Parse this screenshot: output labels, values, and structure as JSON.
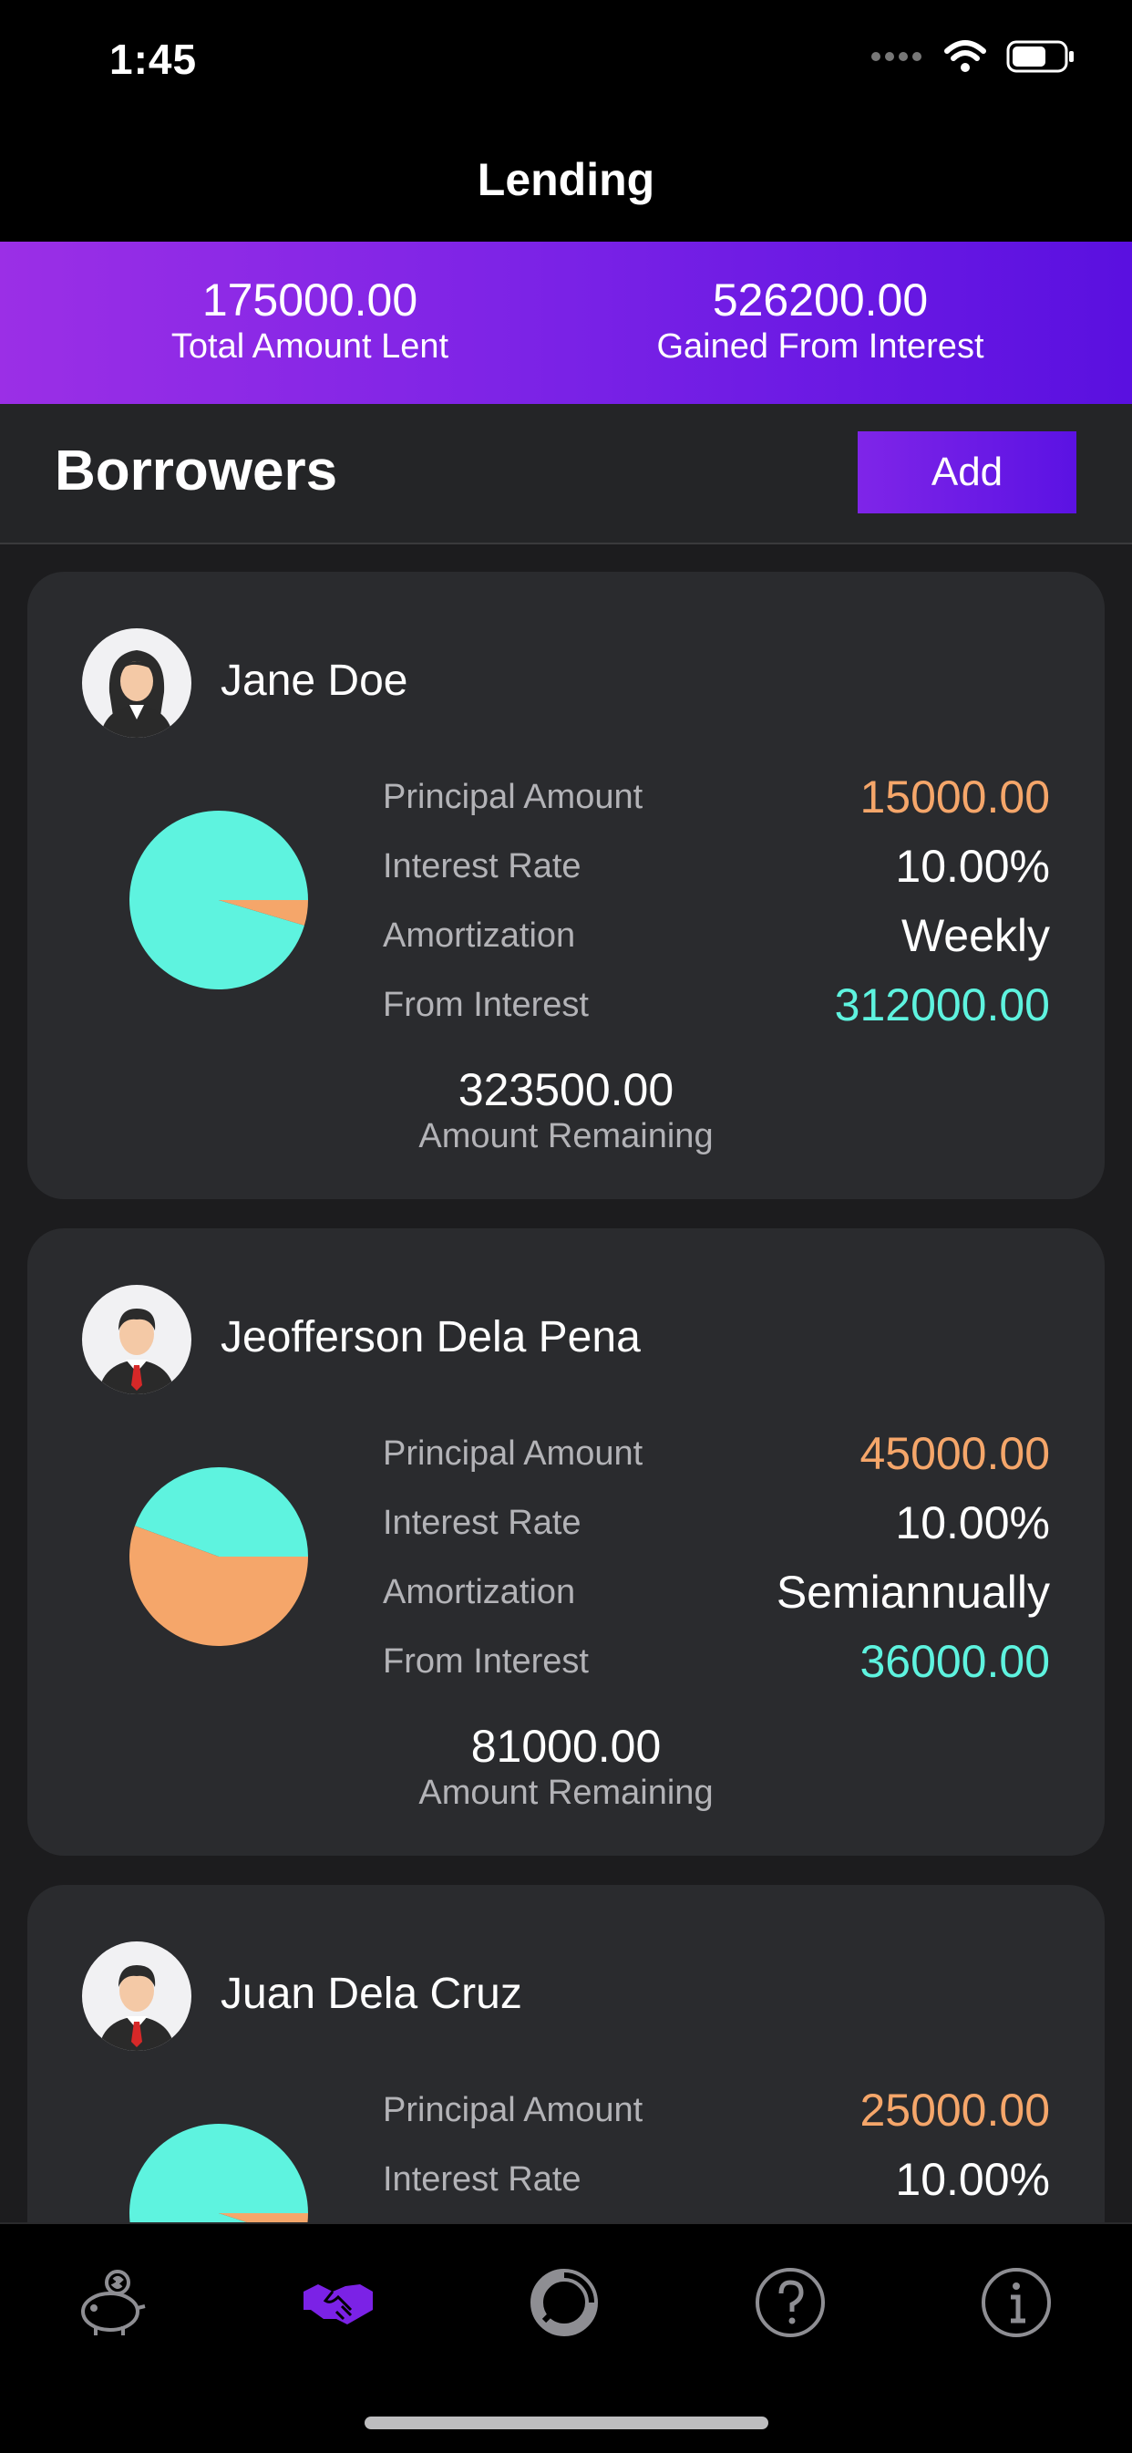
{
  "status_bar": {
    "time": "1:45",
    "icons": [
      "signal-icon",
      "wifi-icon",
      "battery-icon"
    ]
  },
  "nav": {
    "title": "Lending"
  },
  "summary": {
    "total_lent": "175000.00",
    "total_lent_label": "Total Amount Lent",
    "gained_interest": "526200.00",
    "gained_interest_label": "Gained From Interest"
  },
  "borrowers_section": {
    "title": "Borrowers",
    "add_label": "Add"
  },
  "borrowers": [
    {
      "name": "Jane Doe",
      "avatar": "female-avatar",
      "principal_label": "Principal Amount",
      "principal": "15000.00",
      "rate_label": "Interest Rate",
      "rate": "10.00%",
      "amortization_label": "Amortization",
      "amortization": "Weekly",
      "interest_label": "From Interest",
      "interest": "312000.00",
      "remaining": "323500.00",
      "remaining_label": "Amount Remaining",
      "pie": {
        "principal_fraction": 0.046,
        "interest_fraction": 0.954
      }
    },
    {
      "name": "Jeofferson Dela Pena",
      "avatar": "male-avatar",
      "principal_label": "Principal Amount",
      "principal": "45000.00",
      "rate_label": "Interest Rate",
      "rate": "10.00%",
      "amortization_label": "Amortization",
      "amortization": "Semiannually",
      "interest_label": "From Interest",
      "interest": "36000.00",
      "remaining": "81000.00",
      "remaining_label": "Amount Remaining",
      "pie": {
        "principal_fraction": 0.556,
        "interest_fraction": 0.444
      }
    },
    {
      "name": "Juan Dela Cruz",
      "avatar": "male-avatar",
      "principal_label": "Principal Amount",
      "principal": "25000.00",
      "rate_label": "Interest Rate",
      "rate": "10.00%",
      "pie": {
        "principal_fraction": 0.05,
        "interest_fraction": 0.95
      }
    }
  ],
  "tab_bar": {
    "items": [
      {
        "icon": "piggy-bank-icon",
        "active": false
      },
      {
        "icon": "handshake-icon",
        "active": true
      },
      {
        "icon": "chart-ring-icon",
        "active": false
      },
      {
        "icon": "help-icon",
        "active": false
      },
      {
        "icon": "info-icon",
        "active": false
      }
    ]
  },
  "colors": {
    "accent": "#7b22e6",
    "principal": "#f5a66a",
    "interest": "#5ef3df"
  }
}
